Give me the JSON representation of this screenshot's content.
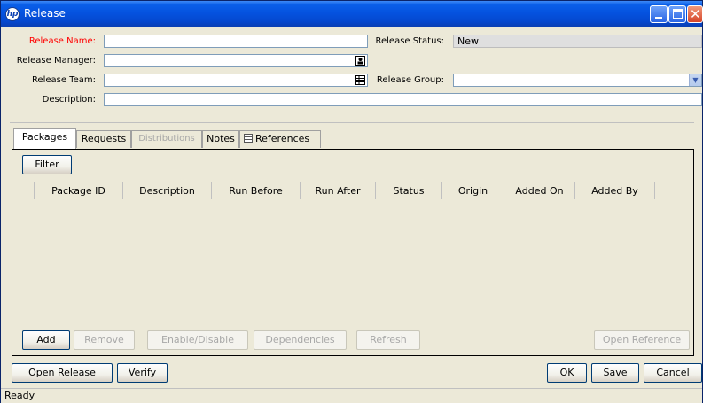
{
  "window": {
    "title": "Release",
    "logo_text": "hp"
  },
  "form": {
    "release_name_label": "Release Name:",
    "release_name_value": "",
    "release_manager_label": "Release Manager:",
    "release_manager_value": "",
    "release_team_label": "Release Team:",
    "release_team_value": "",
    "description_label": "Description:",
    "description_value": "",
    "release_status_label": "Release Status:",
    "release_status_value": "New",
    "release_group_label": "Release Group:",
    "release_group_value": ""
  },
  "tabs": [
    {
      "label": "Packages",
      "active": true,
      "disabled": false
    },
    {
      "label": "Requests",
      "active": false,
      "disabled": false
    },
    {
      "label": "Distributions",
      "active": false,
      "disabled": true
    },
    {
      "label": "Notes",
      "active": false,
      "disabled": false
    },
    {
      "label": "References",
      "active": false,
      "disabled": false,
      "icon": "list-icon"
    }
  ],
  "packages": {
    "filter_label": "Filter",
    "columns": [
      "Package ID",
      "Description",
      "Run Before",
      "Run After",
      "Status",
      "Origin",
      "Added On",
      "Added By"
    ],
    "rows": [],
    "buttons": {
      "add": "Add",
      "remove": "Remove",
      "enable_disable": "Enable/Disable",
      "dependencies": "Dependencies",
      "refresh": "Refresh",
      "open_reference": "Open Reference"
    }
  },
  "footer": {
    "open_release": "Open Release",
    "verify": "Verify",
    "ok": "OK",
    "save": "Save",
    "cancel": "Cancel"
  },
  "status": {
    "text": "Ready"
  }
}
